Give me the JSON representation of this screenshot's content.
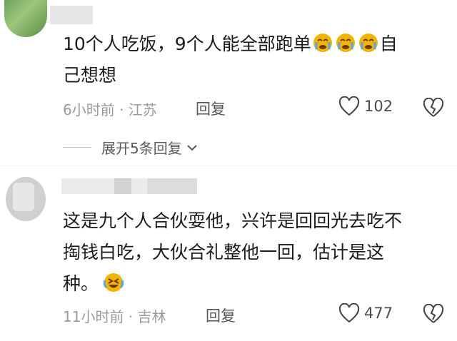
{
  "comments": [
    {
      "text_part1": "10个人吃饭，9个人能全部跑单",
      "text_part2": "自",
      "text_line2": "己想想",
      "time": "6小时前",
      "location": "江苏",
      "reply_label": "回复",
      "likes": "102",
      "expand_label": "展开5条回复"
    },
    {
      "text_line1": "这是九个人合伙耍他，兴许是回回光去吃不",
      "text_line2": "掏钱白吃，大伙合礼整他一回，估计是这",
      "text_line3": "种。",
      "time": "11小时前",
      "location": "吉林",
      "reply_label": "回复",
      "likes": "477"
    }
  ],
  "icons": [
    "heart-outline-icon",
    "broken-heart-icon",
    "crying-emoji",
    "laughing-crying-emoji",
    "chevron-down-icon"
  ],
  "colors": {
    "text": "#1c1c1c",
    "meta": "#9a9a9a",
    "emoji": "#f5b400"
  }
}
